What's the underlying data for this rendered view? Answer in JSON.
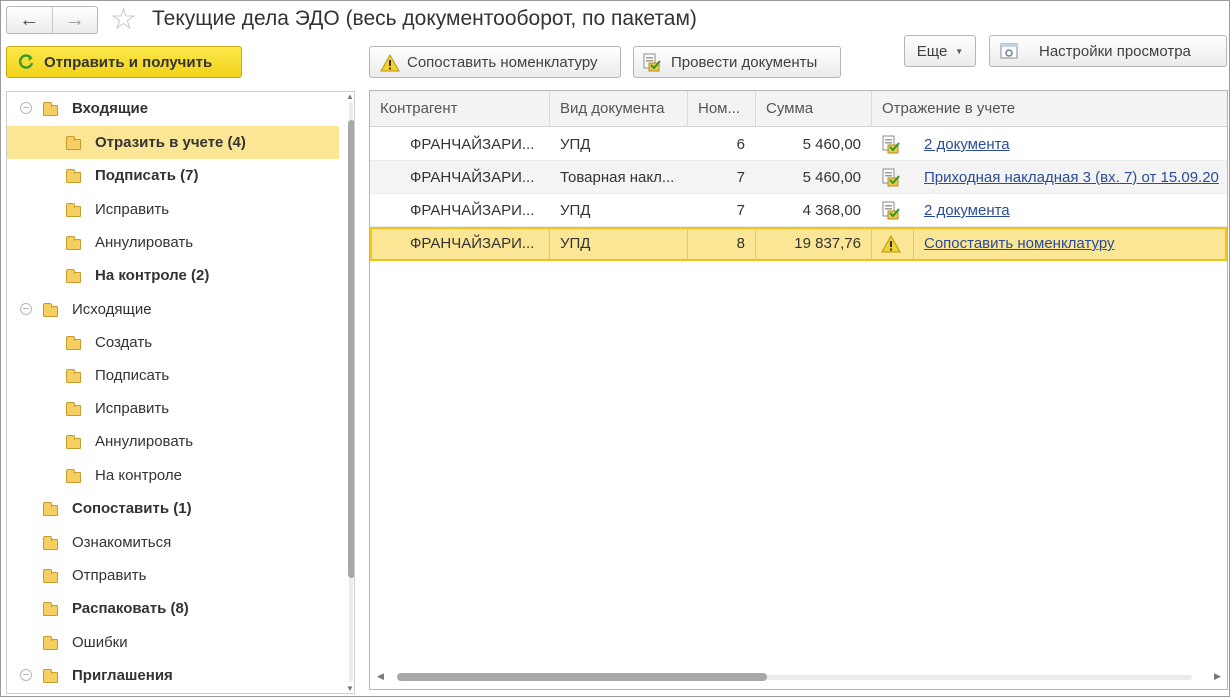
{
  "header": {
    "title": "Текущие дела ЭДО (весь документооборот, по пакетам)"
  },
  "toolbar": {
    "send_receive": "Отправить и получить",
    "match_nomenclature": "Сопоставить номенклатуру",
    "post_documents": "Провести документы",
    "more": "Еще",
    "view_settings": "Настройки просмотра"
  },
  "tree": {
    "items": [
      {
        "label": "Входящие"
      },
      {
        "label": "Отразить в учете (4)"
      },
      {
        "label": "Подписать (7)"
      },
      {
        "label": "Исправить"
      },
      {
        "label": "Аннулировать"
      },
      {
        "label": "На контроле (2)"
      },
      {
        "label": "Исходящие"
      },
      {
        "label": "Создать"
      },
      {
        "label": "Подписать"
      },
      {
        "label": "Исправить"
      },
      {
        "label": "Аннулировать"
      },
      {
        "label": "На контроле"
      },
      {
        "label": "Сопоставить (1)"
      },
      {
        "label": "Ознакомиться"
      },
      {
        "label": "Отправить"
      },
      {
        "label": "Распаковать (8)"
      },
      {
        "label": "Ошибки"
      },
      {
        "label": "Приглашения"
      }
    ]
  },
  "grid": {
    "columns": [
      "Контрагент",
      "Вид документа",
      "Ном...",
      "Сумма",
      "Отражение в учете"
    ],
    "rows": [
      {
        "counterparty": "ФРАНЧАЙЗАРИ...",
        "doc_type": "УПД",
        "number": "6",
        "sum": "5 460,00",
        "status_icon": "posted-document-icon",
        "reflection": "2 документа"
      },
      {
        "counterparty": "ФРАНЧАЙЗАРИ...",
        "doc_type": "Товарная накл...",
        "number": "7",
        "sum": "5 460,00",
        "status_icon": "posted-document-icon",
        "reflection": "Приходная накладная 3 (вх. 7) от 15.09.20"
      },
      {
        "counterparty": "ФРАНЧАЙЗАРИ...",
        "doc_type": "УПД",
        "number": "7",
        "sum": "4 368,00",
        "status_icon": "posted-document-icon",
        "reflection": "2 документа"
      },
      {
        "counterparty": "ФРАНЧАЙЗАРИ...",
        "doc_type": "УПД",
        "number": "8",
        "sum": "19 837,76",
        "status_icon": "warning-icon",
        "reflection": "Сопоставить номенклатуру"
      }
    ]
  },
  "colors": {
    "primary_button": "#f2d31b",
    "selection": "#fbe696",
    "link": "#2a4c98"
  }
}
